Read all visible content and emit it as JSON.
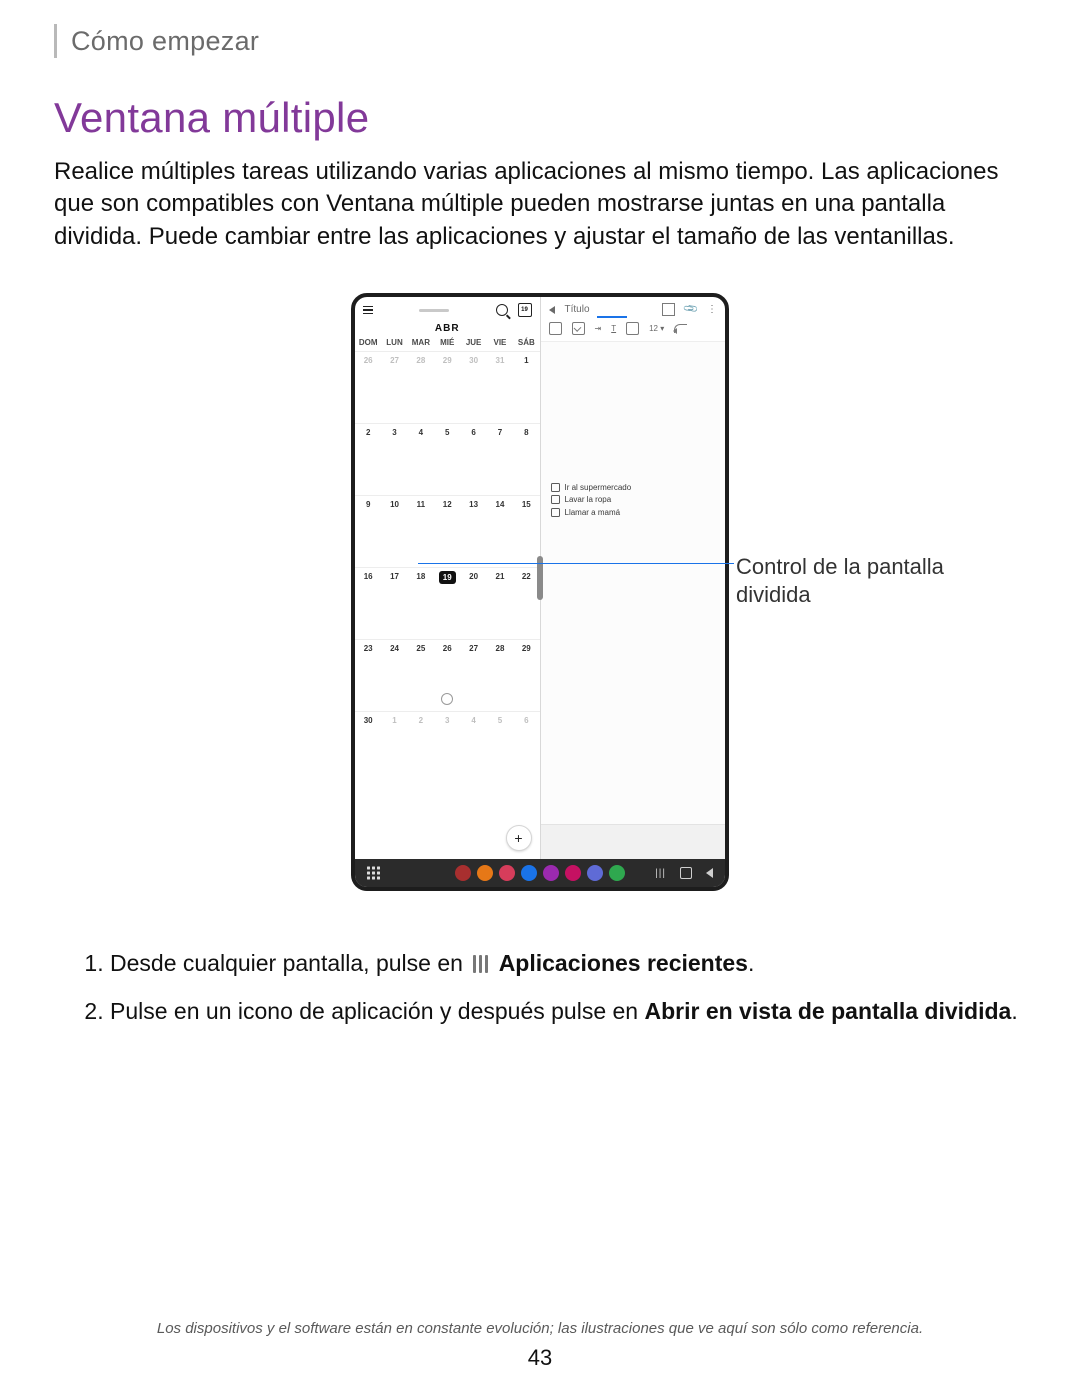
{
  "breadcrumb": "Cómo empezar",
  "title": "Ventana múltiple",
  "intro": "Realice múltiples tareas utilizando varias aplicaciones al mismo tiempo. Las aplicaciones que son compatibles con Ventana múltiple pueden mostrarse juntas en una pantalla dividida. Puede cambiar entre las aplicaciones y ajustar el tamaño de las ventanillas.",
  "callout_label": "Control de la pantalla dividida",
  "calendar": {
    "month_label": "ABR",
    "today_badge": "19",
    "dow": [
      "DOM",
      "LUN",
      "MAR",
      "MIÉ",
      "JUE",
      "VIE",
      "SÁB"
    ],
    "weeks": [
      [
        {
          "d": "26",
          "muted": true
        },
        {
          "d": "27",
          "muted": true
        },
        {
          "d": "28",
          "muted": true
        },
        {
          "d": "29",
          "muted": true
        },
        {
          "d": "30",
          "muted": true
        },
        {
          "d": "31",
          "muted": true
        },
        {
          "d": "1"
        }
      ],
      [
        {
          "d": "2"
        },
        {
          "d": "3"
        },
        {
          "d": "4"
        },
        {
          "d": "5"
        },
        {
          "d": "6"
        },
        {
          "d": "7"
        },
        {
          "d": "8"
        }
      ],
      [
        {
          "d": "9"
        },
        {
          "d": "10"
        },
        {
          "d": "11"
        },
        {
          "d": "12"
        },
        {
          "d": "13"
        },
        {
          "d": "14"
        },
        {
          "d": "15"
        }
      ],
      [
        {
          "d": "16"
        },
        {
          "d": "17"
        },
        {
          "d": "18"
        },
        {
          "d": "19",
          "today": true
        },
        {
          "d": "20"
        },
        {
          "d": "21"
        },
        {
          "d": "22"
        }
      ],
      [
        {
          "d": "23"
        },
        {
          "d": "24"
        },
        {
          "d": "25"
        },
        {
          "d": "26",
          "smiley": true
        },
        {
          "d": "27"
        },
        {
          "d": "28"
        },
        {
          "d": "29"
        }
      ],
      [
        {
          "d": "30"
        },
        {
          "d": "1",
          "muted": true
        },
        {
          "d": "2",
          "muted": true
        },
        {
          "d": "3",
          "muted": true
        },
        {
          "d": "4",
          "muted": true
        },
        {
          "d": "5",
          "muted": true
        },
        {
          "d": "6",
          "muted": true
        }
      ]
    ],
    "fab_label": "+"
  },
  "notes": {
    "title_placeholder": "Título",
    "font_size_label": "12",
    "checklist": [
      "Ir al supermercado",
      "Lavar la ropa",
      "Llamar a mamá"
    ]
  },
  "taskbar": {
    "app_colors": [
      "#a82f2f",
      "#e67817",
      "#d63d5b",
      "#1a73e8",
      "#9b2aaf",
      "#c51162",
      "#5f6bd6",
      "#2fa84f"
    ],
    "recents_glyph": "|||"
  },
  "steps": {
    "s1_lead": "Desde cualquier pantalla, pulse en ",
    "s1_bold": "Aplicaciones recientes",
    "s1_tail": ".",
    "s2_lead": "Pulse en un icono de aplicación y después pulse en ",
    "s2_bold": "Abrir en vista de pantalla dividida",
    "s2_tail": "."
  },
  "disclaimer": "Los dispositivos y el software están en constante evolución; las ilustraciones que ve aquí son sólo como referencia.",
  "page_number": "43"
}
